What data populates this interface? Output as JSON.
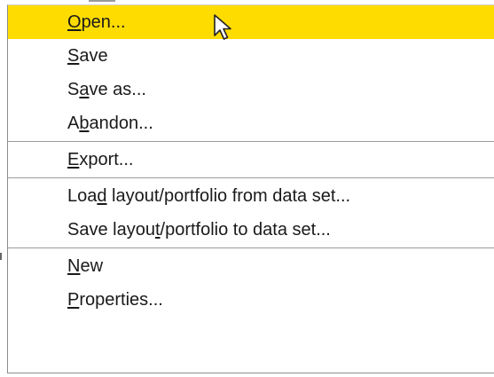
{
  "menu": {
    "items": [
      {
        "pre": "",
        "u": "O",
        "post": "pen...",
        "highlighted": true
      },
      {
        "pre": "",
        "u": "S",
        "post": "ave",
        "highlighted": false
      },
      {
        "pre": "S",
        "u": "a",
        "post": "ve as...",
        "highlighted": false
      },
      {
        "pre": "A",
        "u": "b",
        "post": "andon...",
        "highlighted": false
      },
      {
        "pre": "",
        "u": "E",
        "post": "xport...",
        "highlighted": false
      },
      {
        "pre": "Loa",
        "u": "d",
        "post": " layout/portfolio from data set...",
        "highlighted": false
      },
      {
        "pre": "Save layou",
        "u": "t",
        "post": "/portfolio to data set...",
        "highlighted": false
      },
      {
        "pre": "",
        "u": "N",
        "post": "ew",
        "highlighted": false
      },
      {
        "pre": "",
        "u": "P",
        "post": "roperties...",
        "highlighted": false
      }
    ],
    "highlight_color": "#ffdc00"
  },
  "cursor": {
    "icon": "mouse-pointer-icon"
  }
}
